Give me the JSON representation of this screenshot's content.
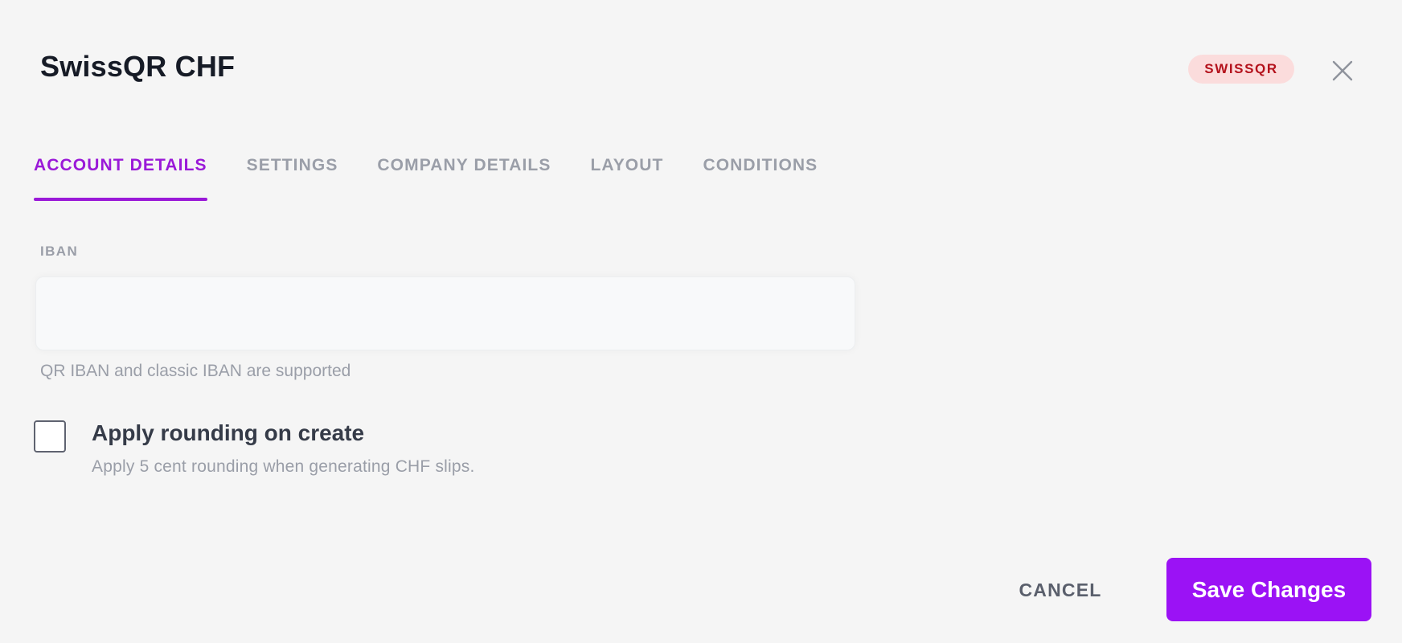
{
  "header": {
    "title": "SwissQR CHF",
    "badge": "SWISSQR",
    "close_icon": "close-icon"
  },
  "tabs": [
    {
      "label": "ACCOUNT DETAILS",
      "active": true
    },
    {
      "label": "SETTINGS",
      "active": false
    },
    {
      "label": "COMPANY DETAILS",
      "active": false
    },
    {
      "label": "LAYOUT",
      "active": false
    },
    {
      "label": "CONDITIONS",
      "active": false
    }
  ],
  "iban": {
    "label": "IBAN",
    "value": "",
    "placeholder": "",
    "hint": "QR IBAN and classic IBAN are supported"
  },
  "rounding": {
    "checked": false,
    "title": "Apply rounding on create",
    "description": "Apply 5 cent rounding when generating CHF slips."
  },
  "footer": {
    "cancel_label": "CANCEL",
    "save_label": "Save Changes"
  },
  "colors": {
    "accent": "#9a19d8",
    "save_button": "#9b12f5",
    "badge_bg": "#fbdcdc",
    "badge_text": "#b4121c",
    "background": "#f5f5f5"
  }
}
